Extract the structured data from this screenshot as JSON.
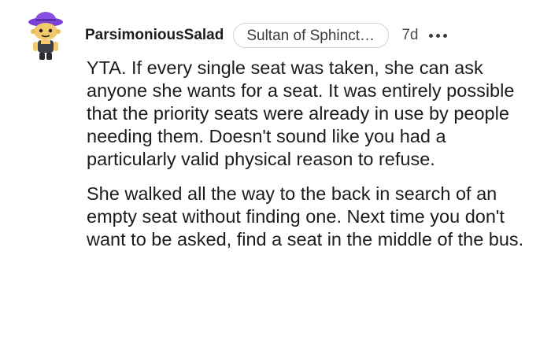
{
  "comment": {
    "avatar_icon": "snoo-avatar-purple-hat-icon",
    "author": "ParsimoniousSalad",
    "flair": "Sultan of Sphincter...",
    "age": "7d",
    "more_icon": "more-options-icon",
    "paragraphs": [
      "YTA. If every single seat was taken, she can ask anyone she wants for a seat. It was entirely possible that the priority seats were already in use by people needing them. Doesn't sound like you had a particularly valid physical reason to refuse.",
      "She walked all the way to the back in search of an empty seat without finding one. Next time you don't want to be asked, find a seat in the middle of the bus."
    ]
  },
  "colors": {
    "text": "#1c1c1c",
    "hat": "#8a4fe0",
    "face": "#f2c96b",
    "shirt": "#3d4047"
  }
}
